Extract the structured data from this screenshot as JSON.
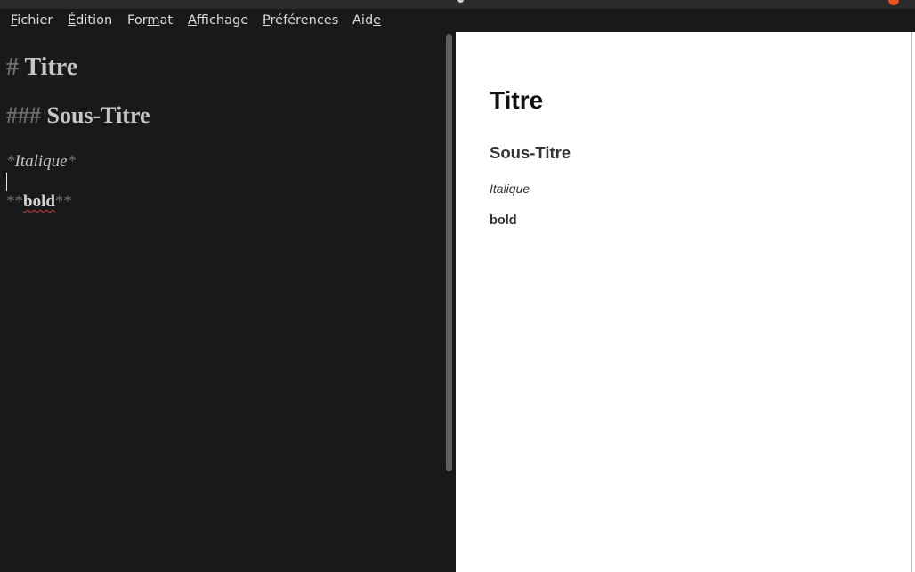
{
  "menu": [
    {
      "before": "",
      "mnemonic": "F",
      "after": "ichier"
    },
    {
      "before": "",
      "mnemonic": "É",
      "after": "dition"
    },
    {
      "before": "For",
      "mnemonic": "m",
      "after": "at"
    },
    {
      "before": "",
      "mnemonic": "A",
      "after": "ffichage"
    },
    {
      "before": "",
      "mnemonic": "P",
      "after": "références"
    },
    {
      "before": "Aid",
      "mnemonic": "e",
      "after": ""
    }
  ],
  "editor": {
    "h1": {
      "marker": "#",
      "text": "Titre"
    },
    "h3": {
      "marker": "###",
      "text": "Sous-Titre"
    },
    "italic": {
      "open": "*",
      "text": "Italique",
      "close": "*"
    },
    "bold": {
      "open": "**",
      "text": "bold",
      "close": "**"
    }
  },
  "preview": {
    "h1": "Titre",
    "h3": "Sous-Titre",
    "italic": "Italique",
    "bold": "bold"
  },
  "colors": {
    "editor_bg": "#18191b",
    "preview_bg": "#ffffff",
    "markdown_marker": "#6d6e70",
    "spellcheck_underline": "#d23c3c",
    "window_close": "#e95420"
  }
}
